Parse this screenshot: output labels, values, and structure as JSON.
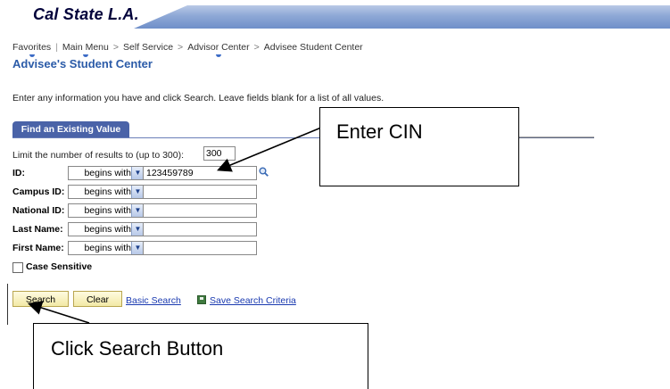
{
  "header": {
    "logo": "Cal State L.A."
  },
  "breadcrumb": {
    "favorites": "Favorites",
    "main_menu": "Main Menu",
    "self_service": "Self Service",
    "advisor_center": "Advisor Center",
    "advisee_student_center": "Advisee Student Center",
    "separator": ">",
    "divider": "|"
  },
  "page": {
    "title": "Advisee's Student Center",
    "instructions": "Enter any information you have and click Search. Leave fields blank for a list of all values."
  },
  "tab": {
    "label": "Find an Existing Value"
  },
  "limit": {
    "label": "Limit the number of results to (up to 300):",
    "value": "300"
  },
  "fields": [
    {
      "label": "ID:",
      "operator": "begins with",
      "value": "123459789"
    },
    {
      "label": "Campus ID:",
      "operator": "begins with",
      "value": ""
    },
    {
      "label": "National ID:",
      "operator": "begins with",
      "value": ""
    },
    {
      "label": "Last Name:",
      "operator": "begins with",
      "value": ""
    },
    {
      "label": "First Name:",
      "operator": "begins with",
      "value": ""
    }
  ],
  "case_sensitive": {
    "label": "Case Sensitive",
    "checked": false
  },
  "buttons": {
    "search": "Search",
    "clear": "Clear"
  },
  "links": {
    "basic_search": "Basic Search",
    "save_search_criteria": "Save Search Criteria"
  },
  "callouts": {
    "enter_cin": "Enter CIN",
    "click_search": "Click Search Button"
  },
  "icons": {
    "lookup": "magnifier-icon",
    "save": "save-disk-icon",
    "dropdown": "chevron-down-icon"
  },
  "colors": {
    "title": "#2b5ba8",
    "tab": "#4a63a8",
    "link": "#1a3ab0",
    "button": "#f2e9a6"
  }
}
